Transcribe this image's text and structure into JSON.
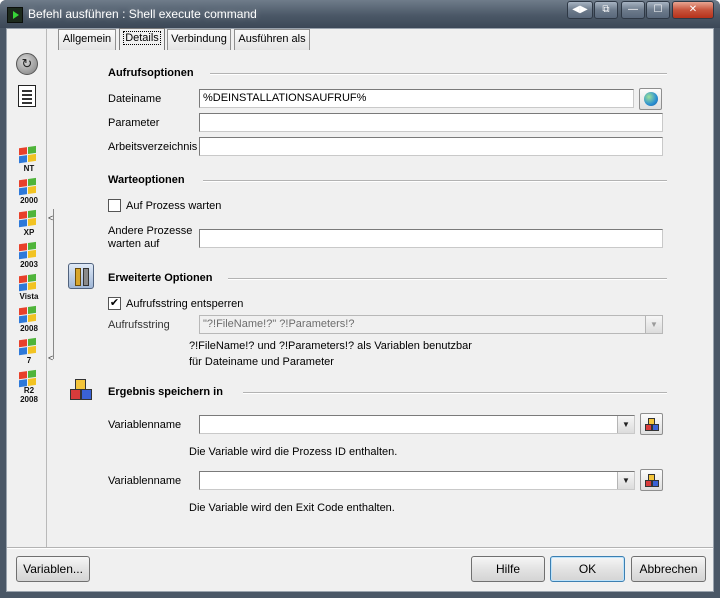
{
  "window": {
    "title": "Befehl ausführen : Shell execute command"
  },
  "titlebar_buttons": {
    "restore_glyph": "◀▶",
    "copy_glyph": "⧉",
    "minimize_glyph": "—",
    "maximize_glyph": "☐",
    "close_glyph": "✕"
  },
  "tabs": [
    {
      "label": "Allgemein",
      "active": false
    },
    {
      "label": "Details",
      "active": true
    },
    {
      "label": "Verbindung",
      "active": false
    },
    {
      "label": "Ausführen als",
      "active": false
    }
  ],
  "sidebar": {
    "os_items": [
      {
        "label": "NT"
      },
      {
        "label": "2000"
      },
      {
        "label": "XP"
      },
      {
        "label": "2003"
      },
      {
        "label": "Vista"
      },
      {
        "label": "2008"
      },
      {
        "label": "7"
      },
      {
        "label": "R2 2008"
      }
    ],
    "collapse_glyph": "<"
  },
  "aufrufoptionen": {
    "title": "Aufrufsoptionen",
    "dateiname_label": "Dateiname",
    "dateiname_value": "%DEINSTALLATIONSAUFRUF%",
    "parameter_label": "Parameter",
    "parameter_value": "",
    "arbeitsverzeichnis_label": "Arbeitsverzeichnis",
    "arbeitsverzeichnis_value": ""
  },
  "warteoptionen": {
    "title": "Warteoptionen",
    "auf_prozess_warten_label": "Auf Prozess warten",
    "auf_prozess_warten_checked": false,
    "andere_prozesse_label_1": "Andere Prozesse",
    "andere_prozesse_label_2": "warten auf",
    "andere_prozesse_value": ""
  },
  "erweiterte_optionen": {
    "title": "Erweiterte Optionen",
    "entsperren_label": "Aufrufsstring entsperren",
    "entsperren_checked": true,
    "checkmark": "✔",
    "aufrufsstring_label": "Aufrufsstring",
    "aufrufsstring_value": "\"?!FileName!?\" ?!Parameters!?",
    "hint_line_1": "?!FileName!? und ?!Parameters!? als Variablen benutzbar",
    "hint_line_2": "für Dateiname und Parameter"
  },
  "ergebnis": {
    "title": "Ergebnis speichern in",
    "var1_label": "Variablenname",
    "var1_value": "",
    "var1_hint": "Die Variable wird die Prozess ID enthalten.",
    "var2_label": "Variablenname",
    "var2_value": "",
    "var2_hint": "Die Variable wird den Exit Code enthalten."
  },
  "dropdown_glyph": "▼",
  "buttons": {
    "variablen": "Variablen...",
    "hilfe": "Hilfe",
    "ok": "OK",
    "abbrechen": "Abbrechen"
  }
}
